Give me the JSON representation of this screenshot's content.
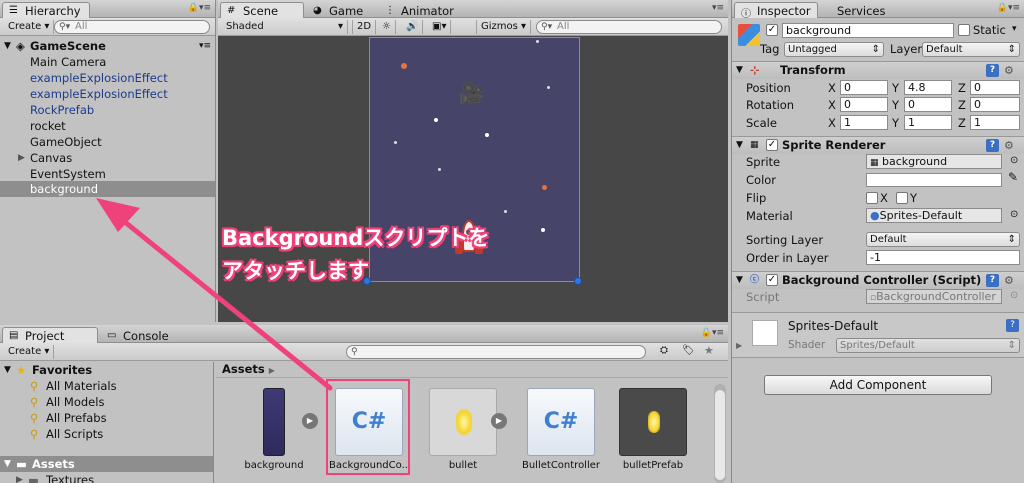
{
  "hierarchy": {
    "tab": "Hierarchy",
    "create": "Create ▾",
    "search_placeholder": "All",
    "scene": "GameScene",
    "items": [
      "Main Camera",
      "exampleExplosionEffect",
      "exampleExplosionEffect",
      "RockPrefab",
      "rocket",
      "GameObject",
      "Canvas",
      "EventSystem",
      "background"
    ]
  },
  "scene": {
    "tabs": [
      "Scene",
      "Game",
      "Animator"
    ],
    "shading": "Shaded",
    "mode_2d": "2D",
    "gizmos": "Gizmos ▾",
    "search_placeholder": "All",
    "bg_color": "#47446a"
  },
  "annotation": {
    "line1": "Backgroundスクリプトを",
    "line2": "アタッチします",
    "color": "#f0427a"
  },
  "inspector": {
    "tabs": [
      "Inspector",
      "Services"
    ],
    "object_name": "background",
    "static_label": "Static",
    "tag_label": "Tag",
    "tag_value": "Untagged",
    "layer_label": "Layer",
    "layer_value": "Default",
    "transform": {
      "title": "Transform",
      "rows": [
        {
          "label": "Position",
          "x": "0",
          "y": "4.8",
          "z": "0"
        },
        {
          "label": "Rotation",
          "x": "0",
          "y": "0",
          "z": "0"
        },
        {
          "label": "Scale",
          "x": "1",
          "y": "1",
          "z": "1"
        }
      ]
    },
    "sprite_renderer": {
      "title": "Sprite Renderer",
      "sprite_label": "Sprite",
      "sprite_value": "background",
      "color_label": "Color",
      "flip_label": "Flip",
      "flip_x": "X",
      "flip_y": "Y",
      "material_label": "Material",
      "material_value": "Sprites-Default",
      "sorting_label": "Sorting Layer",
      "sorting_value": "Default",
      "order_label": "Order in Layer",
      "order_value": "-1"
    },
    "bg_controller": {
      "title": "Background Controller (Script)",
      "script_label": "Script",
      "script_value": "BackgroundController"
    },
    "material": {
      "name": "Sprites-Default",
      "shader_label": "Shader",
      "shader_value": "Sprites/Default"
    },
    "add_component": "Add Component"
  },
  "project": {
    "tabs": [
      "Project",
      "Console"
    ],
    "create": "Create ▾",
    "favorites": "Favorites",
    "fav_items": [
      "All Materials",
      "All Models",
      "All Prefabs",
      "All Scripts"
    ],
    "assets": "Assets",
    "textures": "Textures",
    "breadcrumb": "Assets",
    "items": [
      {
        "name": "background",
        "kind": "texture"
      },
      {
        "name": "BackgroundCo...",
        "kind": "script"
      },
      {
        "name": "bullet",
        "kind": "sprite"
      },
      {
        "name": "BulletController",
        "kind": "script"
      },
      {
        "name": "bulletPrefab",
        "kind": "prefab"
      }
    ]
  }
}
